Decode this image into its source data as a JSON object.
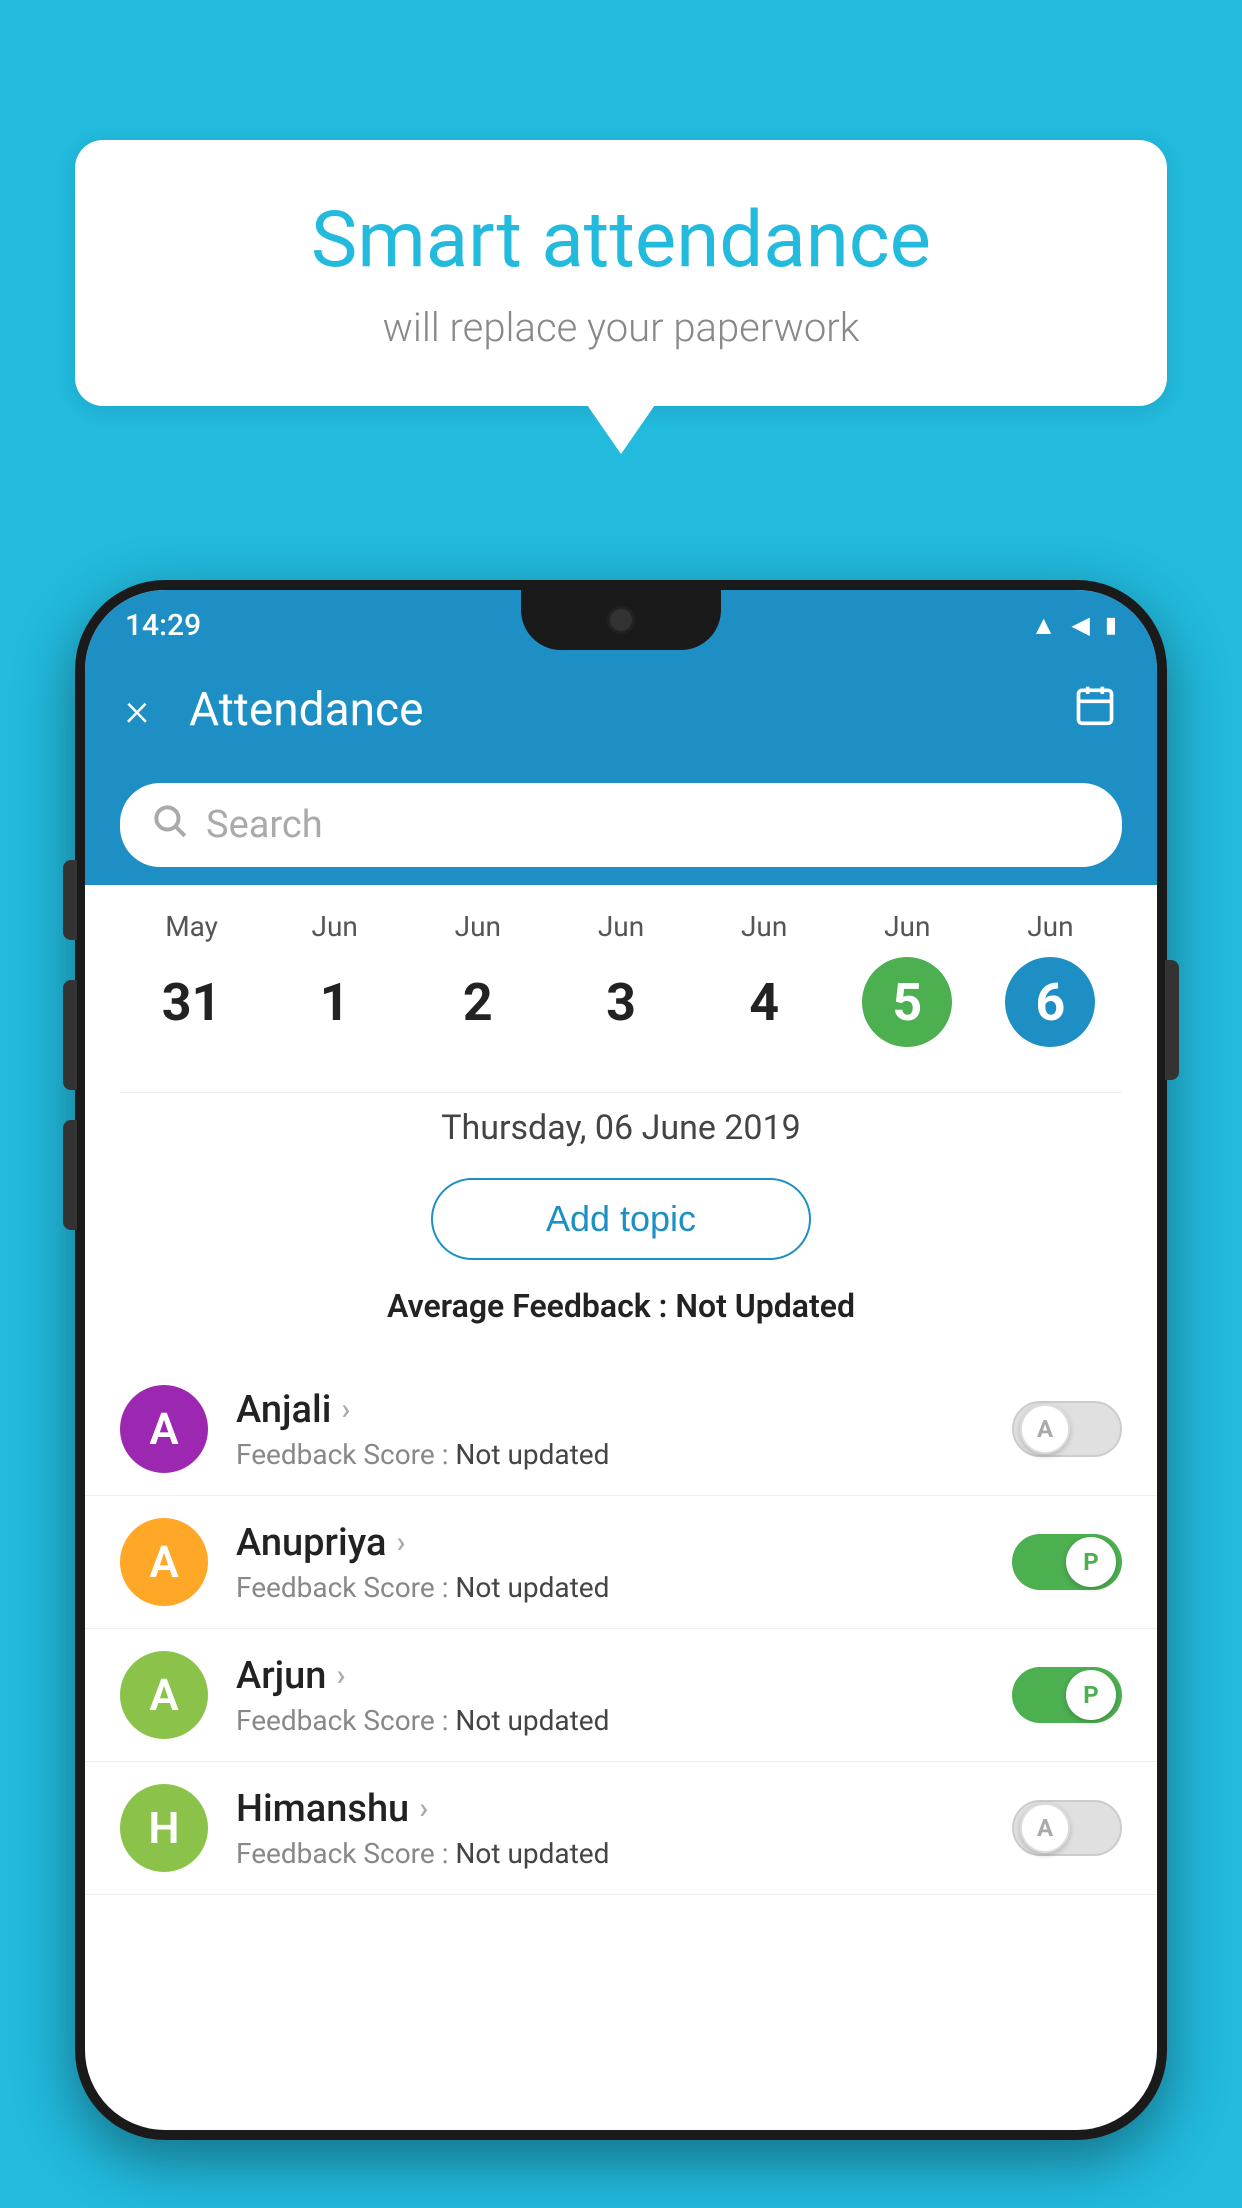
{
  "background_color": "#22badd",
  "speech_bubble": {
    "title": "Smart attendance",
    "subtitle": "will replace your paperwork"
  },
  "status_bar": {
    "time": "14:29",
    "wifi": "wifi-icon",
    "signal": "signal-icon",
    "battery": "battery-icon"
  },
  "header": {
    "title": "Attendance",
    "close_label": "×",
    "calendar_label": "📅"
  },
  "search": {
    "placeholder": "Search"
  },
  "calendar": {
    "days": [
      {
        "month": "May",
        "date": "31",
        "style": "normal"
      },
      {
        "month": "Jun",
        "date": "1",
        "style": "normal"
      },
      {
        "month": "Jun",
        "date": "2",
        "style": "normal"
      },
      {
        "month": "Jun",
        "date": "3",
        "style": "normal"
      },
      {
        "month": "Jun",
        "date": "4",
        "style": "normal"
      },
      {
        "month": "Jun",
        "date": "5",
        "style": "today"
      },
      {
        "month": "Jun",
        "date": "6",
        "style": "selected"
      }
    ]
  },
  "selected_date_label": "Thursday, 06 June 2019",
  "add_topic_label": "Add topic",
  "avg_feedback_label": "Average Feedback : ",
  "avg_feedback_value": "Not Updated",
  "students": [
    {
      "name": "Anjali",
      "avatar_letter": "A",
      "avatar_color": "#9c27b0",
      "feedback_label": "Feedback Score : ",
      "feedback_value": "Not updated",
      "toggle": "off",
      "toggle_letter": "A"
    },
    {
      "name": "Anupriya",
      "avatar_letter": "A",
      "avatar_color": "#ffa726",
      "feedback_label": "Feedback Score : ",
      "feedback_value": "Not updated",
      "toggle": "on",
      "toggle_letter": "P"
    },
    {
      "name": "Arjun",
      "avatar_letter": "A",
      "avatar_color": "#8bc34a",
      "feedback_label": "Feedback Score : ",
      "feedback_value": "Not updated",
      "toggle": "on",
      "toggle_letter": "P"
    },
    {
      "name": "Himanshu",
      "avatar_letter": "H",
      "avatar_color": "#8bc34a",
      "feedback_label": "Feedback Score : ",
      "feedback_value": "Not updated",
      "toggle": "off",
      "toggle_letter": "A"
    }
  ]
}
